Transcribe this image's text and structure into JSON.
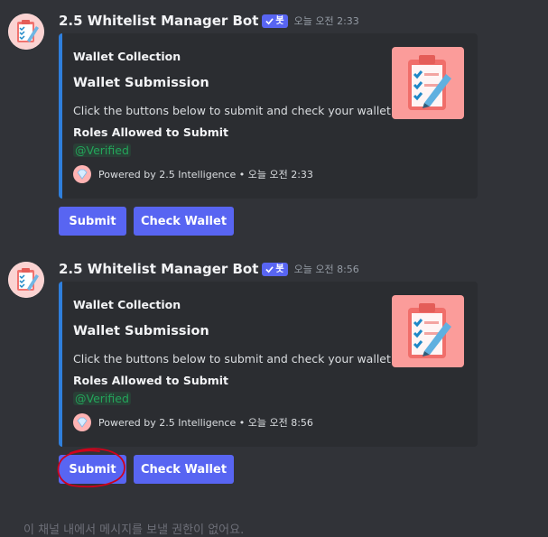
{
  "messages": [
    {
      "username": "2.5 Whitelist Manager Bot",
      "badge": "봇",
      "timestamp": "오늘 오전 2:33",
      "embed": {
        "author": "Wallet Collection",
        "title": "Wallet Submission",
        "description": "Click the buttons below to submit and check your wallet.",
        "field_name": "Roles Allowed to Submit",
        "field_value": "@Verified",
        "footer": "Powered by 2.5 Intelligence • 오늘 오전 2:33"
      },
      "buttons": {
        "submit": "Submit",
        "check": "Check Wallet"
      }
    },
    {
      "username": "2.5 Whitelist Manager Bot",
      "badge": "봇",
      "timestamp": "오늘 오전 8:56",
      "embed": {
        "author": "Wallet Collection",
        "title": "Wallet Submission",
        "description": "Click the buttons below to submit and check your wallet.",
        "field_name": "Roles Allowed to Submit",
        "field_value": "@Verified",
        "footer": "Powered by 2.5 Intelligence • 오늘 오전 8:56"
      },
      "buttons": {
        "submit": "Submit",
        "check": "Check Wallet"
      }
    }
  ],
  "input_hint": "이 채널 내에서 메시지를 보낼 권한이 없어요.",
  "colors": {
    "background": "#313338",
    "embed_background": "#2b2d31",
    "embed_border": "#2f7fdc",
    "button": "#5865f2",
    "role_mention": "#23a55a",
    "annotation_circle": "#d0021b",
    "thumbnail": "#fb9c9a"
  },
  "icons": {
    "avatar": "clipboard-checklist-icon",
    "thumbnail": "clipboard-checklist-icon",
    "footer": "diamond-icon",
    "badge": "checkmark-icon"
  }
}
